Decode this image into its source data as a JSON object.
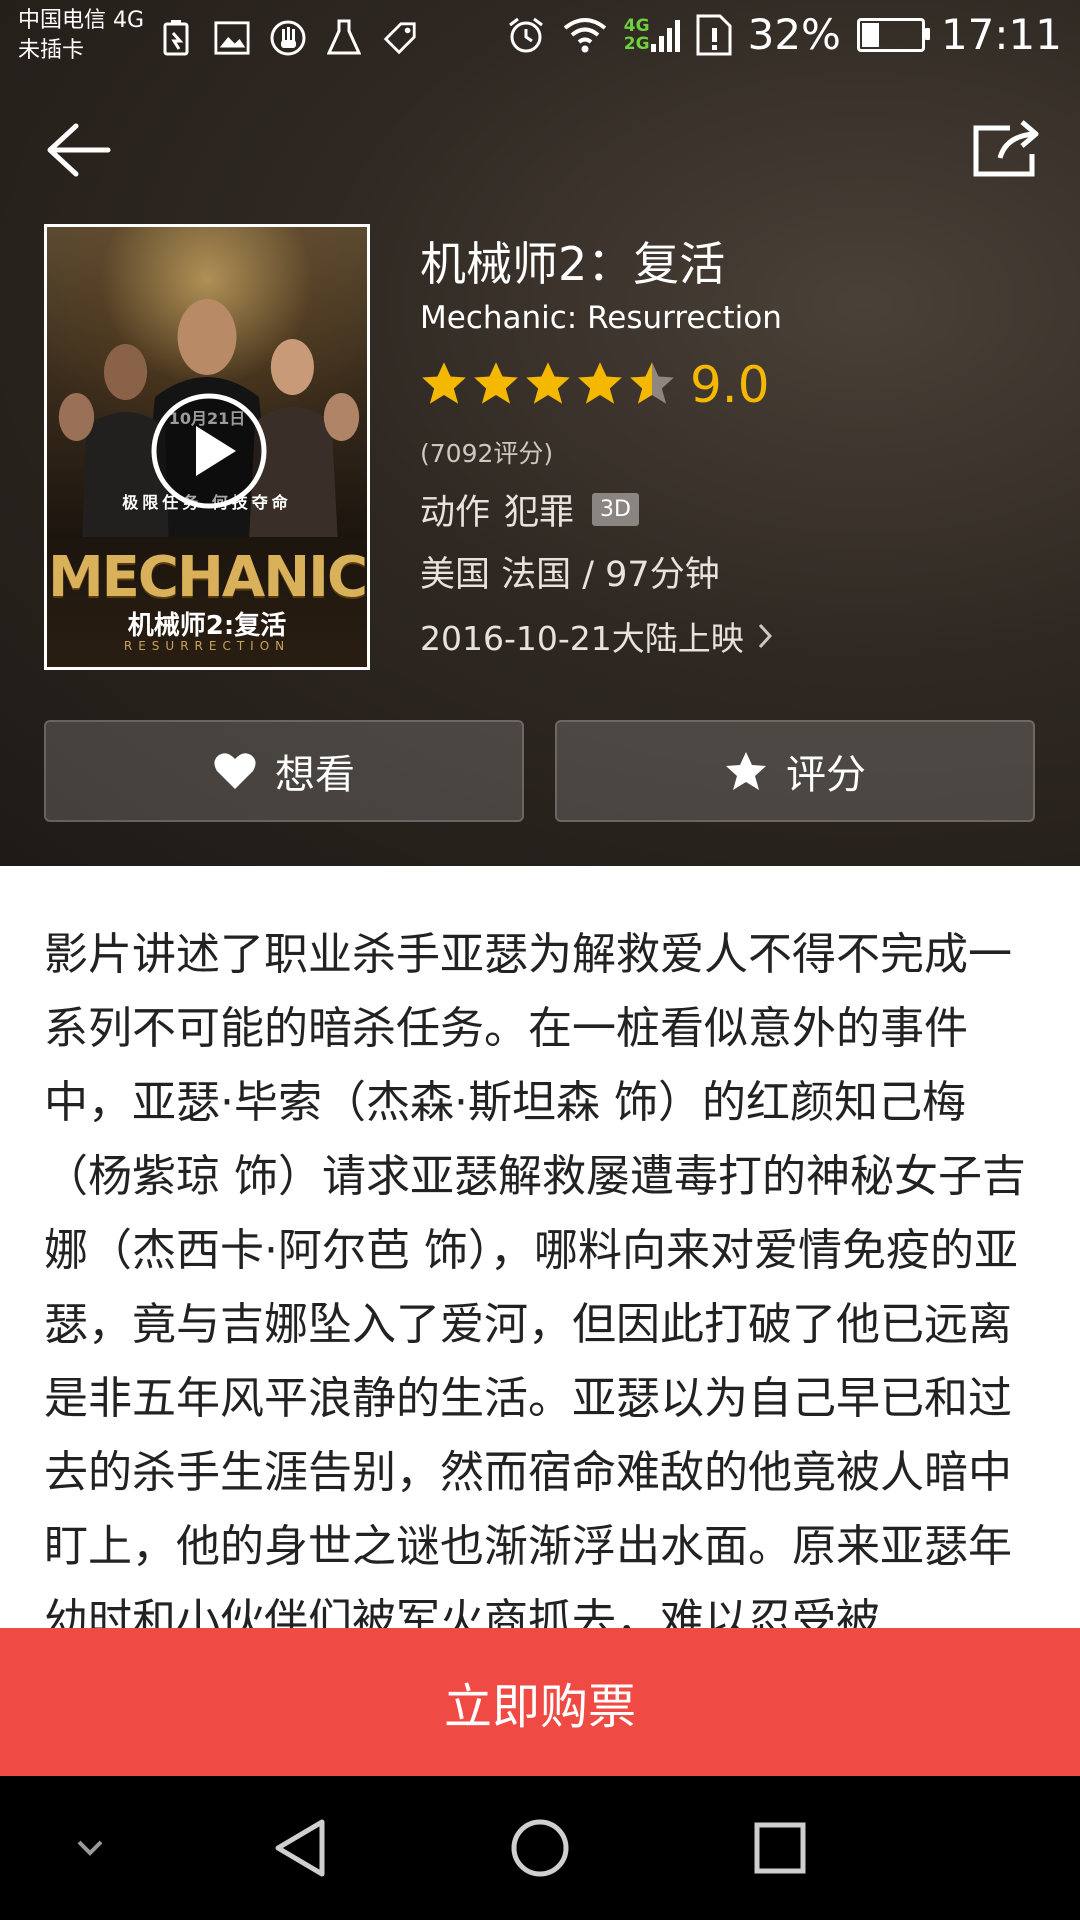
{
  "status_bar": {
    "carrier_line1": "中国电信 4G",
    "carrier_line2": "未插卡",
    "net_top": "4G",
    "net_bottom": "2G",
    "battery_percent": "32%",
    "battery_level": 0.32,
    "time": "17:11"
  },
  "movie": {
    "title_cn": "机械师2：复活",
    "title_en": "Mechanic: Resurrection",
    "stars_value": 4.5,
    "score": "9.0",
    "rating_count": "(7092评分)",
    "genres": [
      "动作",
      "犯罪"
    ],
    "format_badge": "3D",
    "region_duration": "美国  法国 / 97分钟",
    "release": "2016-10-21大陆上映",
    "poster": {
      "title": "MECHANIC",
      "subtitle": "机械师2:复活",
      "resurrection": "RESURRECTION",
      "date": "10月21日",
      "tagline": "极限任务  何技夺命"
    }
  },
  "actions": {
    "want_label": "想看",
    "rate_label": "评分"
  },
  "synopsis": "影片讲述了职业杀手亚瑟为解救爱人不得不完成一系列不可能的暗杀任务。在一桩看似意外的事件中，亚瑟·毕索（杰森·斯坦森 饰）的红颜知己梅（杨紫琼 饰）请求亚瑟解救屡遭毒打的神秘女子吉娜（杰西卡·阿尔芭 饰），哪料向来对爱情免疫的亚瑟，竟与吉娜坠入了爱河，但因此打破了他已远离是非五年风平浪静的生活。亚瑟以为自己早已和过去的杀手生涯告别，然而宿命难敌的他竟被人暗中盯上，他的身世之谜也渐渐浮出水面。原来亚瑟年幼时和小伙伴们被军火商抓去，难以忍受被",
  "buy_button": "立即购票",
  "colors": {
    "accent_red": "#f04a44",
    "star_gold": "#f5b800"
  }
}
